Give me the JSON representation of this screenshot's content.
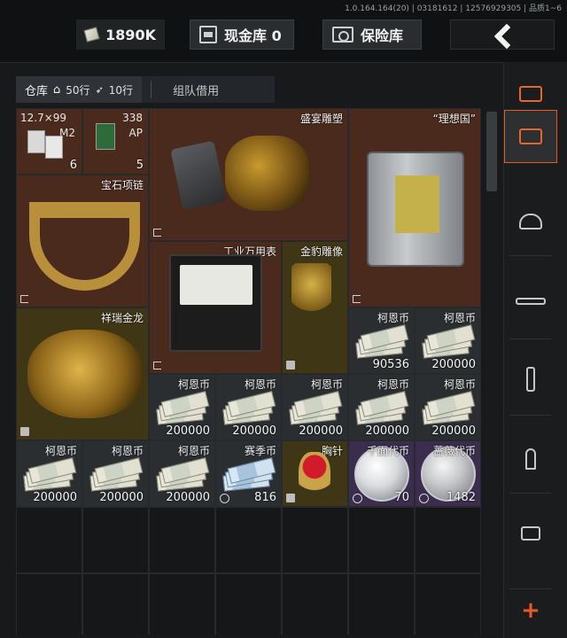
{
  "version_info": "1.0.164.164(20) | 03181612 | 12576929305 | 品质1~6",
  "topbar": {
    "money": "1890K",
    "cash_vault": "现金库 0",
    "safe": "保险库"
  },
  "tabs": {
    "warehouse": "仓库",
    "rows": "50行",
    "ammo_rows": "10行",
    "team_borrow": "组队借用"
  },
  "items": {
    "ammo1": {
      "caliber": "12.7×99",
      "variant": "M2",
      "count": "6"
    },
    "ammo2": {
      "caliber": "338",
      "variant": "AP",
      "count": "5"
    },
    "bust": {
      "name": "盛宴雕塑"
    },
    "case": {
      "name": "“理想国”"
    },
    "necklace": {
      "name": "宝石项链"
    },
    "multimeter": {
      "name": "工业万用表"
    },
    "leopard": {
      "name": "金豹雕像"
    },
    "coin_r4a": {
      "name": "柯恩币",
      "count": "90536"
    },
    "coin_r4b": {
      "name": "柯恩币",
      "count": "200000"
    },
    "dragon": {
      "name": "祥瑞金龙"
    },
    "coin_r5a": {
      "name": "柯恩币",
      "count": "200000"
    },
    "coin_r5b": {
      "name": "柯恩币",
      "count": "200000"
    },
    "coin_r5c": {
      "name": "柯恩币",
      "count": "200000"
    },
    "coin_r5d": {
      "name": "柯恩币",
      "count": "200000"
    },
    "coin_r5e": {
      "name": "柯恩币",
      "count": "200000"
    },
    "coin_r6a": {
      "name": "柯恩币",
      "count": "200000"
    },
    "coin_r6b": {
      "name": "柯恩币",
      "count": "200000"
    },
    "coin_r6c": {
      "name": "柯恩币",
      "count": "200000"
    },
    "season_coin": {
      "name": "赛季币",
      "count": "816"
    },
    "brooch": {
      "name": "胸针"
    },
    "token1": {
      "name": "千面代币",
      "count": "70"
    },
    "token2": {
      "name": "蔷薇代币",
      "count": "1482"
    }
  },
  "sidebar": {
    "add_label": "+"
  },
  "icons": {
    "money": "banknote-icon",
    "cash_vault": "vault-icon",
    "safe": "safe-icon",
    "back": "chevron-left-icon",
    "sidebar": [
      "layers-refresh-icon",
      "storage-icon",
      "helmet-icon",
      "rifle-icon",
      "magazine-icon",
      "bullet-icon",
      "scope-icon"
    ]
  },
  "colors": {
    "accent": "#e3672f",
    "rare_brown": "#4a2a1c",
    "gold_olive": "#3f3616",
    "purple": "#3a2d4e"
  }
}
